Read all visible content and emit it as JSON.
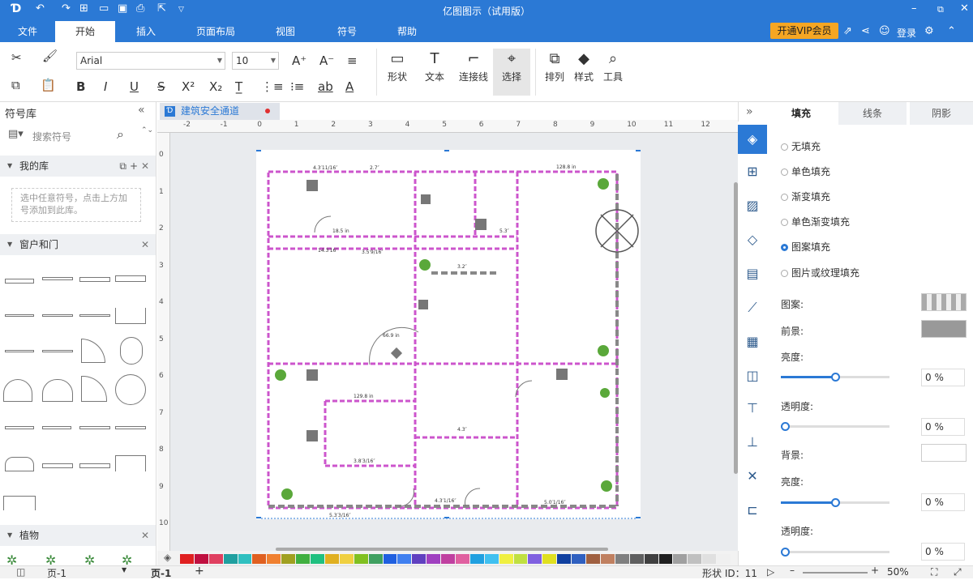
{
  "app": {
    "title": "亿图图示（试用版）"
  },
  "menu": {
    "tabs": [
      "文件",
      "开始",
      "插入",
      "页面布局",
      "视图",
      "符号",
      "帮助"
    ],
    "active": 1,
    "vip": "开通VIP会员",
    "login": "登录"
  },
  "ribbon": {
    "font": "Arial",
    "size": "10",
    "big": [
      {
        "icon": "▭",
        "label": "形状"
      },
      {
        "icon": "T",
        "label": "文本"
      },
      {
        "icon": "⌐",
        "label": "连接线"
      },
      {
        "icon": "⌖",
        "label": "选择"
      }
    ],
    "big2": [
      {
        "icon": "⧉",
        "label": "排列"
      },
      {
        "icon": "◆",
        "label": "样式"
      },
      {
        "icon": "⌕",
        "label": "工具"
      }
    ]
  },
  "left": {
    "title": "符号库",
    "search_placeholder": "搜索符号",
    "my_lib": "我的库",
    "my_lib_hint": "选中任意符号，点击上方加号添加到此库。",
    "doors": "窗户和门",
    "plants": "植物"
  },
  "doc": {
    "tab": "建筑安全通道"
  },
  "ruler": {
    "h": [
      "-2",
      "-1",
      "0",
      "1",
      "2",
      "3",
      "4",
      "5",
      "6",
      "7",
      "8",
      "9",
      "10",
      "11",
      "12"
    ],
    "v": [
      "0",
      "1",
      "2",
      "3",
      "4",
      "5",
      "6",
      "7",
      "8",
      "9",
      "10"
    ]
  },
  "plan": {
    "dims": [
      "4.3′11/16″",
      "2.7″",
      "128.8 in",
      "5.3″",
      "14.3′16″",
      "3.5′9/16″",
      "3.2″",
      "18.5 in",
      "66.9 in",
      "129.8 in",
      "4.3″",
      "5.0′1/16″",
      "4.3′1/16″",
      "3.8′3/16″",
      "5.3′3/16″"
    ]
  },
  "right": {
    "tabs": [
      "填充",
      "线条",
      "阴影"
    ],
    "fills": [
      "无填充",
      "单色填充",
      "渐变填充",
      "单色渐变填充",
      "图案填充",
      "图片或纹理填充"
    ],
    "selected": 4,
    "pattern_label": "图案:",
    "fg_label": "前景:",
    "brightness_label": "亮度:",
    "transparency_label": "透明度:",
    "bg_label": "背景:",
    "brightness2_label": "亮度:",
    "transparency2_label": "透明度:",
    "vals": [
      "0 %",
      "0 %",
      "0 %",
      "0 %"
    ],
    "levels": [
      0.5,
      0.0,
      0.5,
      0.0
    ]
  },
  "status": {
    "page": "页-1",
    "page2": "页-1",
    "shape_id": "形状 ID：11",
    "zoom": "50%"
  },
  "colors": {
    "accent": "#2b79d5",
    "wall": "#cc55cc",
    "vip": "#f5a623"
  }
}
